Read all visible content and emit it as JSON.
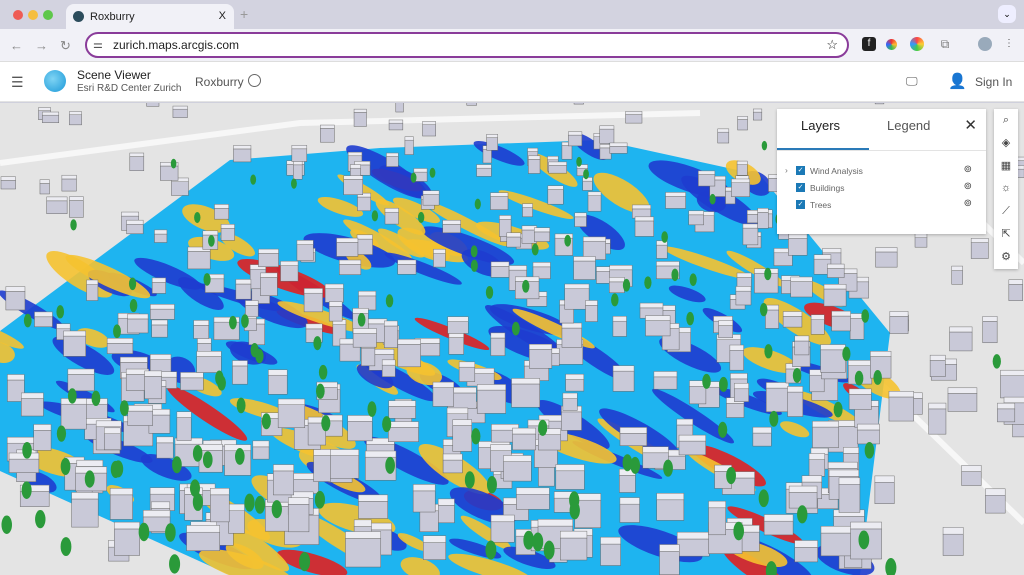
{
  "browser": {
    "tab_title": "Roxburry",
    "url": "zurich.maps.arcgis.com",
    "new_tab": "+",
    "close": "X"
  },
  "app": {
    "title": "Scene Viewer",
    "subtitle": "Esri R&D Center Zurich",
    "scene_name": "Roxburry",
    "sign_in": "Sign In"
  },
  "layers_panel": {
    "tabs": [
      "Layers",
      "Legend"
    ],
    "active_tab": "Layers",
    "layers": [
      {
        "name": "Wind Analysis",
        "checked": true,
        "expandable": true
      },
      {
        "name": "Buildings",
        "checked": true
      },
      {
        "name": "Trees",
        "checked": true
      }
    ]
  },
  "right_toolbar": [
    "search-icon",
    "layers-icon",
    "basemap-icon",
    "daylight-icon",
    "measure-icon",
    "share-icon",
    "settings-icon"
  ],
  "colors": {
    "accent": "#1b79b6",
    "wind_low": "#1e3ccf",
    "wind_mid": "#1eb4f0",
    "wind_high": "#f5c230",
    "wind_max": "#e02020",
    "trees": "#2a9a3a",
    "omnibox": "#8a3c9a"
  }
}
